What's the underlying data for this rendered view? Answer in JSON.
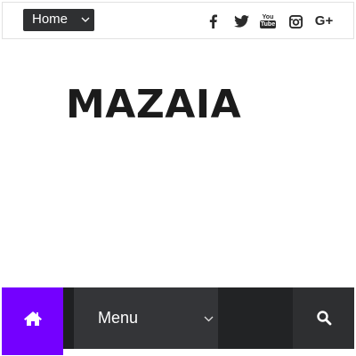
{
  "topbar": {
    "home_select": {
      "selected": "Home"
    },
    "social": [
      {
        "name": "facebook-icon"
      },
      {
        "name": "twitter-icon"
      },
      {
        "name": "youtube-icon",
        "text_top": "You",
        "text_bottom": "Tube"
      },
      {
        "name": "instagram-icon"
      },
      {
        "name": "google-plus-icon",
        "text": "G+"
      }
    ]
  },
  "site": {
    "logo": "MAZAIA"
  },
  "navbar": {
    "home_icon": "home-icon",
    "menu_label": "Menu",
    "search_icon": "search-icon",
    "colors": {
      "home_bg": "#7400ff",
      "bar_bg": "#2b2c2e"
    }
  }
}
